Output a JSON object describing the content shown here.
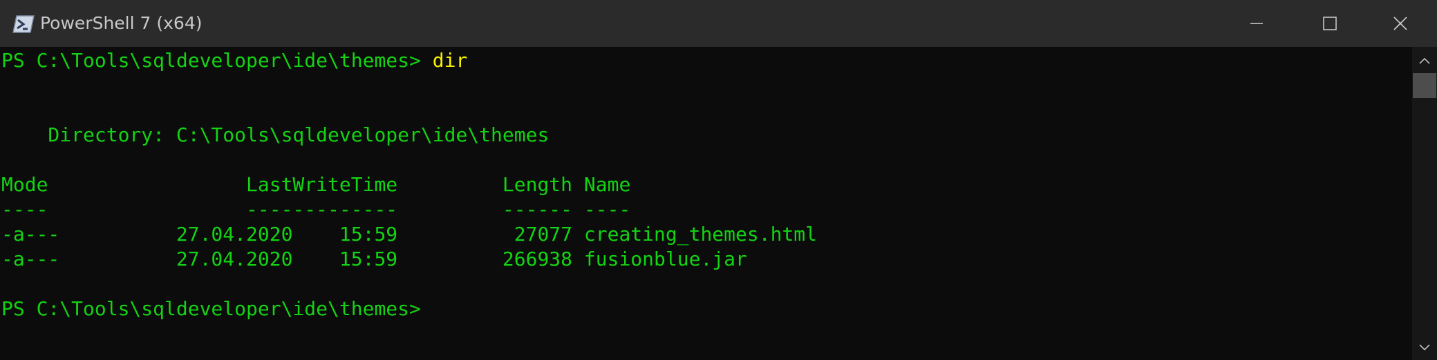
{
  "window": {
    "title": "PowerShell 7 (x64)"
  },
  "terminal": {
    "prompt_line": "PS C:\\Tools\\sqldeveloper\\ide\\themes> ",
    "command": "dir",
    "directory_line": "    Directory: C:\\Tools\\sqldeveloper\\ide\\themes",
    "header_line": "Mode                 LastWriteTime         Length Name",
    "separator_line": "----                 -------------         ------ ----",
    "rows": [
      "-a---          27.04.2020    15:59          27077 creating_themes.html",
      "-a---          27.04.2020    15:59         266938 fusionblue.jar"
    ],
    "final_prompt": "PS C:\\Tools\\sqldeveloper\\ide\\themes>"
  },
  "colors": {
    "text": "#13d313",
    "command": "#f9f100",
    "background": "#0c0c0c",
    "titlebar": "#2b2b2b"
  }
}
